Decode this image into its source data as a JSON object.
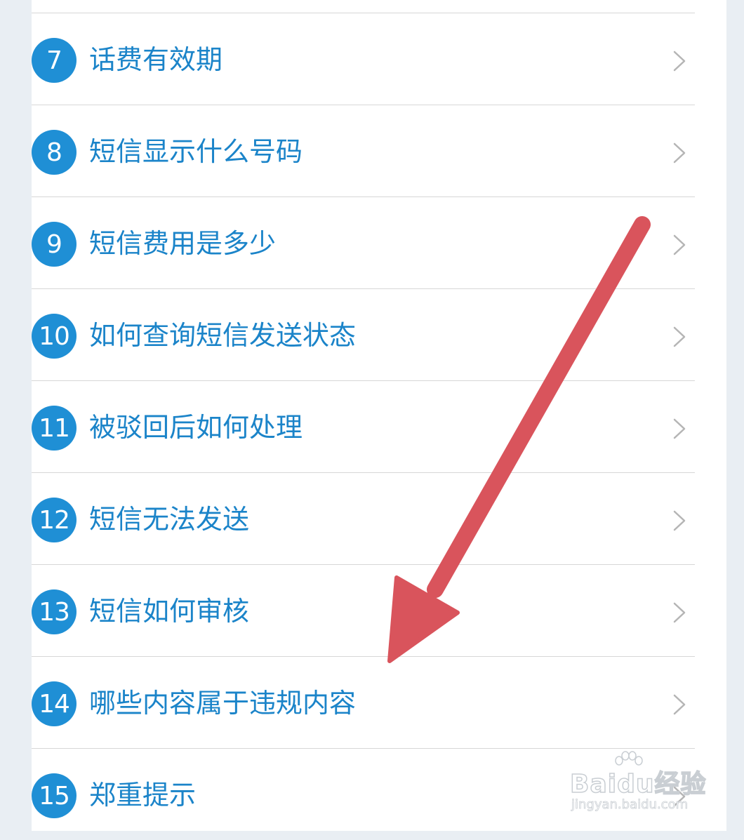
{
  "faq": {
    "items": [
      {
        "number": "7",
        "label": "话费有效期"
      },
      {
        "number": "8",
        "label": "短信显示什么号码"
      },
      {
        "number": "9",
        "label": "短信费用是多少"
      },
      {
        "number": "10",
        "label": "如何查询短信发送状态"
      },
      {
        "number": "11",
        "label": "被驳回后如何处理"
      },
      {
        "number": "12",
        "label": "短信无法发送"
      },
      {
        "number": "13",
        "label": "短信如何审核"
      },
      {
        "number": "14",
        "label": "哪些内容属于违规内容"
      },
      {
        "number": "15",
        "label": "郑重提示"
      }
    ]
  },
  "watermark": {
    "logo_text": "Baidu经验",
    "url": "jingyan.baidu.com"
  },
  "colors": {
    "badge": "#1f8fd5",
    "label_text": "#1b84c9",
    "annotation_arrow": "#d9545c",
    "divider": "#d7d7d7"
  },
  "icons": {
    "row_chevron": "chevron-right-icon",
    "annotation": "red-arrow-annotation"
  }
}
